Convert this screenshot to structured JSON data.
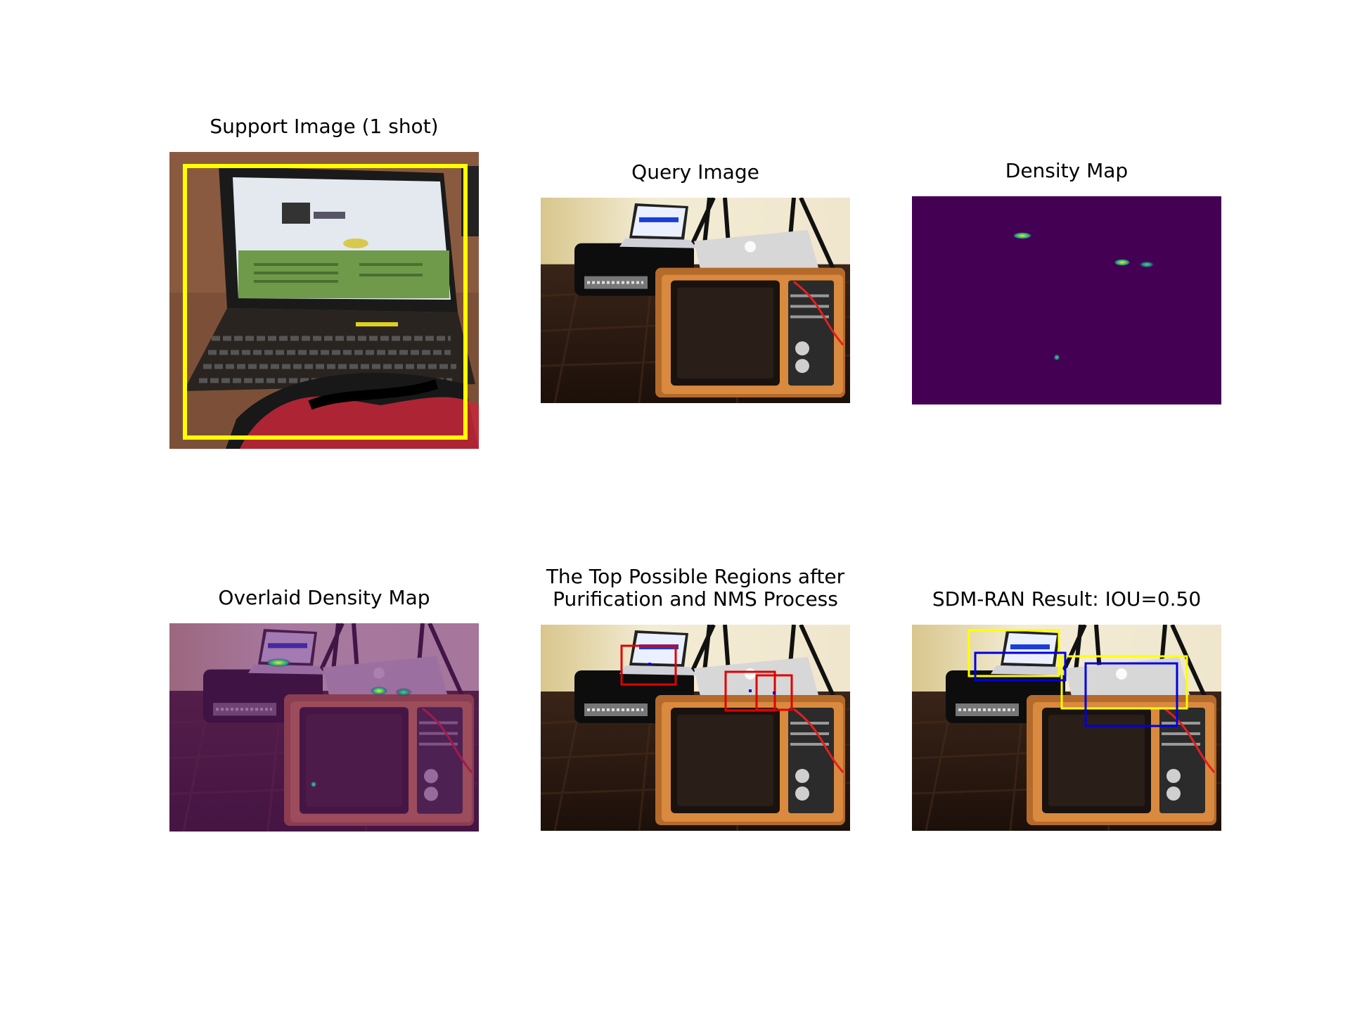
{
  "panels": {
    "support": {
      "title": "Support Image (1 shot)"
    },
    "query": {
      "title": "Query Image"
    },
    "density": {
      "title": "Density Map"
    },
    "overlaid": {
      "title": "Overlaid Density Map"
    },
    "regions": {
      "title_line1": "The Top Possible Regions after",
      "title_line2": "Purification and NMS Process"
    },
    "result": {
      "title": "SDM-RAN Result: IOU=0.50"
    }
  },
  "colors": {
    "support_box": "#ffff00",
    "proposal_box": "#e00000",
    "ground_truth_box": "#ffff00",
    "prediction_box": "#0000e0",
    "density_background": "#440154"
  }
}
